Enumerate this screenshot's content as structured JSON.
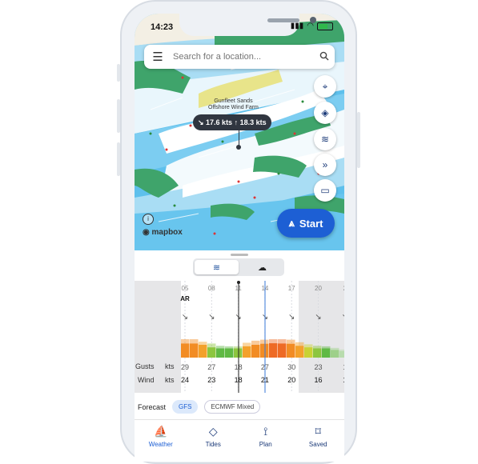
{
  "status": {
    "time": "14:23"
  },
  "search": {
    "placeholder": "Search for a location..."
  },
  "map": {
    "labels": [
      "Gunfleet Sands",
      "Offshore Wind Farm"
    ],
    "tooltip": "↘ 17.6 kts ↑ 18.3 kts",
    "attribution": "mapbox",
    "start_label": "Start"
  },
  "segments": [
    {
      "icon": "wind-icon"
    },
    {
      "icon": "weather-icon"
    }
  ],
  "chart": {
    "hours": [
      "05",
      "08",
      "11",
      "14",
      "17",
      "20",
      "2"
    ],
    "first_badge": "AR",
    "gusts_label": "Gusts",
    "wind_label": "Wind",
    "unit": "kts",
    "gusts": [
      "29",
      "27",
      "18",
      "27",
      "30",
      "23",
      "1"
    ],
    "wind": [
      "24",
      "23",
      "18",
      "21",
      "20",
      "16",
      "1"
    ],
    "bars": [
      {
        "wind": 0.55,
        "gust": 0.72,
        "color": "#f28c24"
      },
      {
        "wind": 0.55,
        "gust": 0.72,
        "color": "#f28c24"
      },
      {
        "wind": 0.5,
        "gust": 0.62,
        "color": "#f3a12b"
      },
      {
        "wind": 0.4,
        "gust": 0.55,
        "color": "#8cc63f"
      },
      {
        "wind": 0.36,
        "gust": 0.46,
        "color": "#5fb944"
      },
      {
        "wind": 0.36,
        "gust": 0.44,
        "color": "#5fb944"
      },
      {
        "wind": 0.36,
        "gust": 0.44,
        "color": "#8cc63f"
      },
      {
        "wind": 0.44,
        "gust": 0.58,
        "color": "#f3a12b"
      },
      {
        "wind": 0.5,
        "gust": 0.66,
        "color": "#f28c24"
      },
      {
        "wind": 0.54,
        "gust": 0.7,
        "color": "#f28c24"
      },
      {
        "wind": 0.56,
        "gust": 0.72,
        "color": "#ee6a25"
      },
      {
        "wind": 0.55,
        "gust": 0.72,
        "color": "#ee6a25"
      },
      {
        "wind": 0.54,
        "gust": 0.7,
        "color": "#f28c24"
      },
      {
        "wind": 0.46,
        "gust": 0.6,
        "color": "#f3a12b"
      },
      {
        "wind": 0.4,
        "gust": 0.52,
        "color": "#c9d233"
      },
      {
        "wind": 0.36,
        "gust": 0.46,
        "color": "#8cc63f"
      },
      {
        "wind": 0.36,
        "gust": 0.44,
        "color": "#5fb944"
      },
      {
        "wind": 0.3,
        "gust": 0.38,
        "color": "#9ed08a"
      },
      {
        "wind": 0.26,
        "gust": 0.32,
        "color": "#b8dcae"
      }
    ]
  },
  "forecast": {
    "label": "Forecast",
    "models": [
      "GFS",
      "ECMWF Mixed"
    ]
  },
  "tabs": [
    {
      "label": "Weather",
      "icon": "windsurf-icon"
    },
    {
      "label": "Tides",
      "icon": "diamond-icon"
    },
    {
      "label": "Plan",
      "icon": "route-icon"
    },
    {
      "label": "Saved",
      "icon": "bookmark-icon"
    }
  ]
}
